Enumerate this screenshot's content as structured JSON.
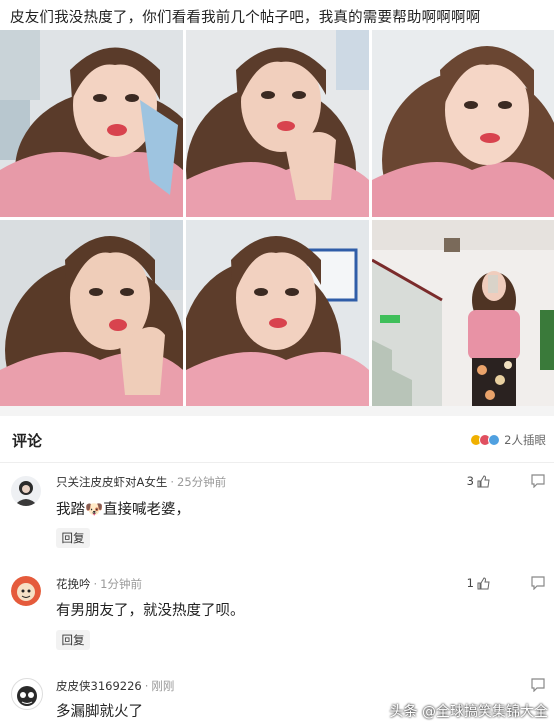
{
  "post": {
    "text": "皮友们我没热度了，你们看看我前几个帖子吧，我真的需要帮助啊啊啊啊"
  },
  "photos": [
    {
      "name": "photo-1",
      "skin": "#f3d3c2",
      "hair": "#5a3b2a",
      "top": "#e79aa8",
      "bg": "#dfe3e6"
    },
    {
      "name": "photo-2",
      "skin": "#f1cfbd",
      "hair": "#5b3c2b",
      "top": "#ea9fae",
      "bg": "#e6e8ea"
    },
    {
      "name": "photo-3",
      "skin": "#f5d6c6",
      "hair": "#6a4632",
      "top": "#e898a8",
      "bg": "#e9ecee"
    },
    {
      "name": "photo-4",
      "skin": "#efcdb9",
      "hair": "#593a28",
      "top": "#ea9fac",
      "bg": "#d9dde0"
    },
    {
      "name": "photo-5",
      "skin": "#f2d1c0",
      "hair": "#5d3d2b",
      "top": "#eca2b0",
      "bg": "#e3e7ea"
    },
    {
      "name": "photo-6",
      "skin": "#f0cdbd",
      "hair": "#4f3424",
      "top": "#e892a5",
      "bg": "#f1eeec"
    }
  ],
  "comments_section": {
    "title": "评论",
    "reacted_text": "2人插眼"
  },
  "comments": [
    {
      "user": "只关注皮皮虾对A女生",
      "time": "25分钟前",
      "text": "我踏🐶直接喊老婆，",
      "likes": "3",
      "reply": "回复"
    },
    {
      "user": "花挽吟",
      "time": "1分钟前",
      "text": "有男朋友了，就没热度了呗。",
      "likes": "1",
      "reply": "回复"
    },
    {
      "user": "皮皮侠3169226",
      "time": "刚刚",
      "text": "多漏脚就火了",
      "likes": "",
      "reply": ""
    }
  ],
  "watermark": "头条 @全球搞笑集锦大全",
  "colors": {
    "accent": "#222222",
    "muted": "#999999",
    "reply_bg": "#f2f2f2",
    "divider": "#f4f4f4"
  }
}
